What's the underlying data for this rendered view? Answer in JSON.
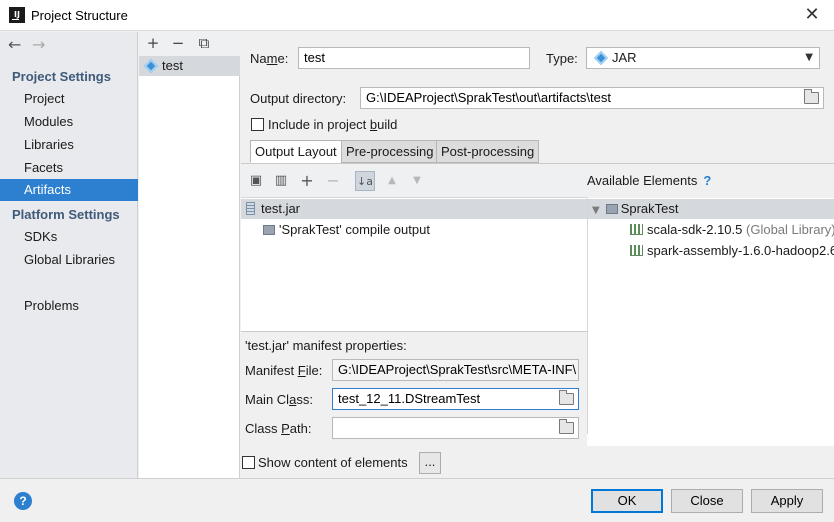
{
  "window": {
    "title": "Project Structure",
    "close_glyph": "✕"
  },
  "nav": {
    "back_glyph": "←",
    "forward_glyph": "→",
    "project_settings_label": "Project Settings",
    "project_items": [
      "Project",
      "Modules",
      "Libraries",
      "Facets",
      "Artifacts"
    ],
    "platform_settings_label": "Platform Settings",
    "platform_items": [
      "SDKs",
      "Global Libraries"
    ],
    "problems_label": "Problems",
    "selected": "Artifacts"
  },
  "artifacts": {
    "toolbar": {
      "add": "+",
      "remove": "−",
      "copy": "⧉"
    },
    "items": [
      "test"
    ]
  },
  "form": {
    "name_label_pre": "Na",
    "name_label_u": "m",
    "name_label_post": "e:",
    "name_value": "test",
    "type_label": "Type:",
    "type_value": "JAR",
    "output_dir_label": "Output directory:",
    "output_dir_value": "G:\\IDEAProject\\SprakTest\\out\\artifacts\\test",
    "include_pre": "Include in project ",
    "include_u": "b",
    "include_post": "uild"
  },
  "tabs": [
    "Output Layout",
    "Pre-processing",
    "Post-processing"
  ],
  "layout_toolbar": {
    "new_folder": "▣",
    "archive": "▥",
    "add": "+",
    "remove": "−",
    "sort": "↓a",
    "up": "▲",
    "down": "▼"
  },
  "layout_tree": {
    "root": "test.jar",
    "child": "'SprakTest' compile output"
  },
  "available": {
    "header": "Available Elements",
    "help": "?",
    "module": "SprakTest",
    "libs": [
      {
        "name": "scala-sdk-2.10.5",
        "scope": "(Global Library)"
      },
      {
        "name": "spark-assembly-1.6.0-hadoop2.6",
        "scope": ""
      }
    ]
  },
  "manifest": {
    "title": "'test.jar' manifest properties:",
    "manifest_file_label_pre": "Manifest ",
    "manifest_file_label_u": "F",
    "manifest_file_label_post": "ile:",
    "manifest_file_value": "G:\\IDEAProject\\SprakTest\\src\\META-INF\\",
    "main_class_label_pre": "Main Cl",
    "main_class_label_u": "a",
    "main_class_label_post": "ss:",
    "main_class_value": "test_12_11.DStreamTest",
    "class_path_label_pre": "Class ",
    "class_path_label_u": "P",
    "class_path_label_post": "ath:",
    "class_path_value": ""
  },
  "show_content_label": "Show content of elements",
  "ellipsis_label": "...",
  "footer": {
    "help": "?",
    "ok": "OK",
    "close": "Close",
    "apply": "Apply"
  }
}
